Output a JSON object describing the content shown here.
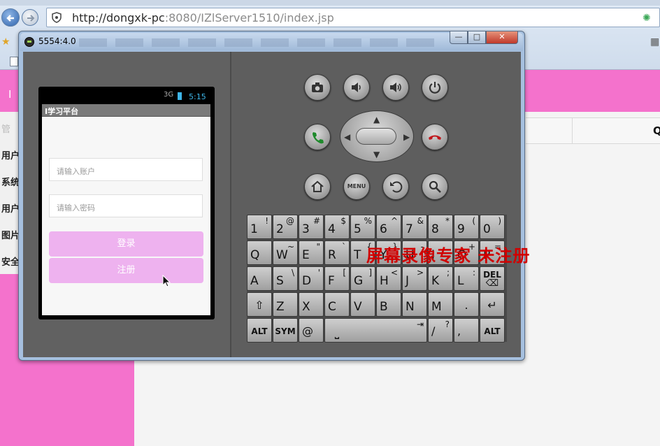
{
  "browser": {
    "url_host": "http://dongxk-pc",
    "url_rest": ":8080/IZlServer1510/index.jsp"
  },
  "page_behind": {
    "header_fragment": "I",
    "side_tab_fragment": "管",
    "side_menu": [
      "用户",
      "系统",
      "用户",
      "图片",
      "安全"
    ],
    "table_header_fragment": "Q"
  },
  "emulator": {
    "window_title": "5554:4.0",
    "window_buttons": {
      "minimize": "—",
      "maximize": "□",
      "close": "✕"
    },
    "status_bar": {
      "signal": "3G",
      "time": "5:15"
    },
    "app": {
      "title": "I学习平台",
      "account_placeholder": "请输入账户",
      "password_placeholder": "请输入密码",
      "login_label": "登录",
      "register_label": "注册"
    },
    "hardware_keys": [
      "camera-icon",
      "volume-down-icon",
      "volume-up-icon",
      "power-icon",
      "call-icon",
      "end-call-icon",
      "home-icon",
      "MENU",
      "back-icon",
      "search-icon"
    ],
    "keyboard": {
      "row1": [
        [
          "1",
          "!"
        ],
        [
          "2",
          "@"
        ],
        [
          "3",
          "#"
        ],
        [
          "4",
          "$"
        ],
        [
          "5",
          "%"
        ],
        [
          "6",
          "^"
        ],
        [
          "7",
          "&"
        ],
        [
          "8",
          "*"
        ],
        [
          "9",
          "("
        ],
        [
          "0",
          ")"
        ]
      ],
      "row2": [
        [
          "Q",
          ""
        ],
        [
          "W",
          "~"
        ],
        [
          "E",
          "\""
        ],
        [
          "R",
          "`"
        ],
        [
          "T",
          "{"
        ],
        [
          "Y",
          "}"
        ],
        [
          "U",
          "-"
        ],
        [
          "I",
          ""
        ],
        [
          "O",
          "+"
        ],
        [
          "P",
          "="
        ]
      ],
      "row3": [
        [
          "A",
          ""
        ],
        [
          "S",
          "\\"
        ],
        [
          "D",
          "'"
        ],
        [
          "F",
          "["
        ],
        [
          "G",
          "]"
        ],
        [
          "H",
          "<"
        ],
        [
          "J",
          ">"
        ],
        [
          "K",
          ";"
        ],
        [
          "L",
          ":"
        ],
        [
          "DEL",
          ""
        ]
      ],
      "row4": [
        [
          "⇧",
          ""
        ],
        [
          "Z",
          ""
        ],
        [
          "X",
          ""
        ],
        [
          "C",
          ""
        ],
        [
          "V",
          ""
        ],
        [
          "B",
          ""
        ],
        [
          "N",
          ""
        ],
        [
          "M",
          ""
        ],
        [
          ".",
          ""
        ],
        [
          "↵",
          ""
        ]
      ],
      "row5": {
        "alt_left": "ALT",
        "sym": "SYM",
        "at": "@",
        "slash": "/",
        "question": "?",
        "comma": ",",
        "alt_right": "ALT"
      }
    }
  },
  "watermark": "屏幕录像专家 未注册",
  "colors": {
    "pink": "#f472cc",
    "button_pink": "#eeb2ef",
    "watermark": "#d10000"
  }
}
